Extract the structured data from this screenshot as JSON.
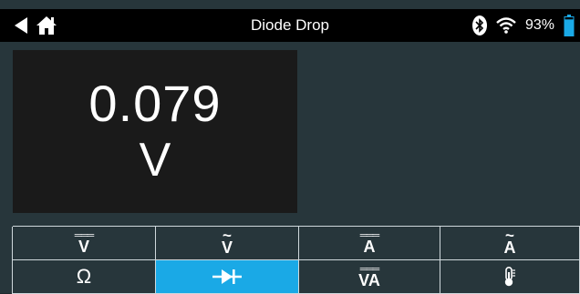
{
  "header": {
    "title": "Diode Drop",
    "battery_percent": "93%",
    "battery_level": 0.93
  },
  "reading": {
    "value": "0.079",
    "unit": "V"
  },
  "modes": [
    {
      "label": "V",
      "indicator": "DC",
      "name": "mode-dc-voltage"
    },
    {
      "label": "V",
      "indicator": "AC",
      "name": "mode-ac-voltage"
    },
    {
      "label": "A",
      "indicator": "DC",
      "name": "mode-dc-current"
    },
    {
      "label": "A",
      "indicator": "AC",
      "name": "mode-ac-current"
    },
    {
      "label": "Ω",
      "indicator": "",
      "name": "mode-resistance"
    },
    {
      "label": "",
      "indicator": "diode",
      "name": "mode-diode",
      "active": true
    },
    {
      "label": "VA",
      "indicator": "DC",
      "name": "mode-dc-power"
    },
    {
      "label": "",
      "indicator": "thermometer",
      "name": "mode-temperature"
    }
  ],
  "colors": {
    "background": "#27363b",
    "header": "#000000",
    "reading_panel": "#1a1a1a",
    "active_mode": "#1aa9e6",
    "battery": "#1aa9e6"
  },
  "icons": {
    "back": "back-arrow-icon",
    "home": "home-icon",
    "bluetooth": "bluetooth-icon",
    "wifi": "wifi-icon",
    "battery": "battery-icon"
  }
}
